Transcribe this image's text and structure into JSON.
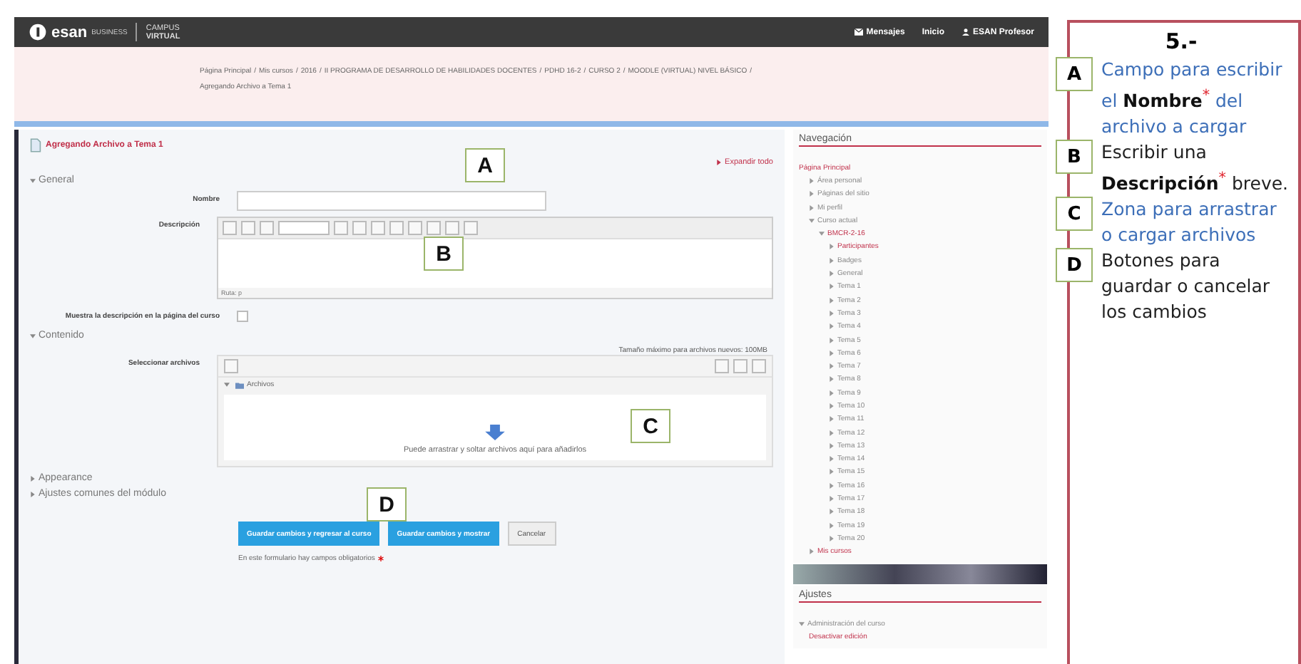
{
  "topbar": {
    "logo": {
      "name": "esan",
      "tag": "BUSINESS",
      "line1": "CAMPUS",
      "line2": "VIRTUAL"
    },
    "links": [
      {
        "kind": "mail",
        "label": "Mensajes"
      },
      {
        "kind": "plain",
        "label": "Inicio"
      },
      {
        "kind": "user",
        "label": "ESAN Profesor"
      }
    ]
  },
  "breadcrumb": {
    "separator": "/",
    "items": [
      "Página Principal",
      "Mis cursos",
      "2016",
      "II PROGRAMA DE DESARROLLO DE HABILIDADES DOCENTES",
      "PDHD 16-2",
      "CURSO 2",
      "MOODLE (VIRTUAL) NIVEL BÁSICO",
      "Agregando Archivo a Tema 1"
    ]
  },
  "form": {
    "title": "Agregando Archivo a Tema 1",
    "expand_all": "Expandir todo",
    "general": {
      "heading": "General",
      "name_field": {
        "label": "Nombre",
        "callout": "A"
      },
      "description": {
        "label": "Descripción",
        "path": "Ruta: p",
        "callout": "B"
      },
      "show_description": {
        "label": "Muestra la descripción en la página del curso",
        "checked": false
      }
    },
    "content": {
      "heading": "Contenido",
      "select_label": "Seleccionar archivos",
      "max_size": "Tamaño máximo para archivos nuevos: 100MB",
      "folder": "Archivos",
      "drop_text": "Puede arrastrar y soltar archivos aquí para añadirlos",
      "callout": "C"
    },
    "collapsed_sections": [
      "Appearance",
      "Ajustes comunes del módulo"
    ],
    "buttons": [
      {
        "kind": "primary",
        "label": "Guardar cambios y regresar al curso"
      },
      {
        "kind": "primary",
        "label": "Guardar cambios y mostrar"
      },
      {
        "kind": "secondary",
        "label": "Cancelar"
      }
    ],
    "buttons_callout": "D",
    "required_note": "En este formulario hay campos obligatorios"
  },
  "navigation": {
    "title": "Navegación",
    "tree": [
      {
        "label": "Página Principal",
        "link": true,
        "children": [
          {
            "label": "Área personal",
            "link": false,
            "expanded": false
          },
          {
            "label": "Páginas del sitio",
            "link": false,
            "expanded": false
          },
          {
            "label": "Mi perfil",
            "link": false,
            "expanded": false
          },
          {
            "label": "Curso actual",
            "link": false,
            "expanded": true,
            "children": [
              {
                "label": "BMCR-2-16",
                "link": true,
                "expanded": true,
                "children": [
                  {
                    "label": "Participantes",
                    "link": true,
                    "expanded": false
                  },
                  {
                    "label": "Badges",
                    "link": false,
                    "expanded": false
                  },
                  {
                    "label": "General",
                    "link": false,
                    "expanded": false
                  },
                  {
                    "label": "Tema 1",
                    "link": false,
                    "expanded": false
                  },
                  {
                    "label": "Tema 2",
                    "link": false,
                    "expanded": false
                  },
                  {
                    "label": "Tema 3",
                    "link": false,
                    "expanded": false
                  },
                  {
                    "label": "Tema 4",
                    "link": false,
                    "expanded": false
                  },
                  {
                    "label": "Tema 5",
                    "link": false,
                    "expanded": false
                  },
                  {
                    "label": "Tema 6",
                    "link": false,
                    "expanded": false
                  },
                  {
                    "label": "Tema 7",
                    "link": false,
                    "expanded": false
                  },
                  {
                    "label": "Tema 8",
                    "link": false,
                    "expanded": false
                  },
                  {
                    "label": "Tema 9",
                    "link": false,
                    "expanded": false
                  },
                  {
                    "label": "Tema 10",
                    "link": false,
                    "expanded": false
                  },
                  {
                    "label": "Tema 11",
                    "link": false,
                    "expanded": false
                  },
                  {
                    "label": "Tema 12",
                    "link": false,
                    "expanded": false
                  },
                  {
                    "label": "Tema 13",
                    "link": false,
                    "expanded": false
                  },
                  {
                    "label": "Tema 14",
                    "link": false,
                    "expanded": false
                  },
                  {
                    "label": "Tema 15",
                    "link": false,
                    "expanded": false
                  },
                  {
                    "label": "Tema 16",
                    "link": false,
                    "expanded": false
                  },
                  {
                    "label": "Tema 17",
                    "link": false,
                    "expanded": false
                  },
                  {
                    "label": "Tema 18",
                    "link": false,
                    "expanded": false
                  },
                  {
                    "label": "Tema 19",
                    "link": false,
                    "expanded": false
                  },
                  {
                    "label": "Tema 20",
                    "link": false,
                    "expanded": false
                  }
                ]
              }
            ]
          },
          {
            "label": "Mis cursos",
            "link": true,
            "expanded": false
          }
        ]
      }
    ]
  },
  "settings": {
    "title": "Ajustes",
    "tree": [
      {
        "label": "Administración del curso",
        "link": false,
        "expanded": true,
        "children": [
          {
            "label": "Desactivar edición",
            "link": true
          }
        ]
      }
    ]
  },
  "notes": {
    "title": "5.-",
    "items": [
      {
        "letter": "A",
        "text": "Campo para escribir el **Nombre**$^{*}$ del archivo a cargar",
        "color": "#3d6fb8"
      },
      {
        "letter": "B",
        "text": "Escribir una **Descripción**$^{*}$ breve.",
        "color": "#222222"
      },
      {
        "letter": "C",
        "text": "Zona para arrastrar o cargar archivos",
        "color": "#3d6fb8"
      },
      {
        "letter": "D",
        "text": "Botones para guardar o cancelar los cambios",
        "color": "#222222"
      }
    ]
  }
}
